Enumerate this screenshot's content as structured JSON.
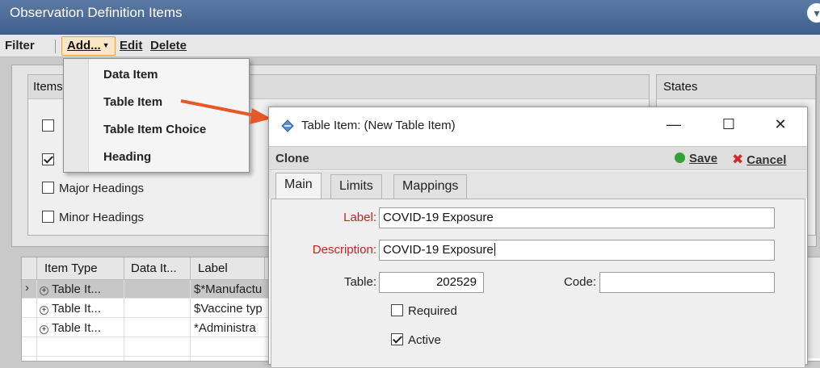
{
  "window": {
    "title": "Observation Definition Items"
  },
  "menu": {
    "filter": "Filter",
    "add": "Add...",
    "edit": "Edit",
    "delete": "Delete"
  },
  "items_panel": {
    "header": "Items",
    "checkboxes": [
      {
        "label": "Major Headings",
        "checked": false
      },
      {
        "label": "Minor Headings",
        "checked": false
      }
    ]
  },
  "states_panel": {
    "header": "States"
  },
  "add_menu": {
    "items": [
      "Data Item",
      "Table Item",
      "Table Item Choice",
      "Heading"
    ]
  },
  "grid": {
    "columns": [
      "Item Type",
      "Data It...",
      "Label"
    ],
    "rows": [
      {
        "type": "Table It...",
        "data_item": "",
        "label": "$*Manufactu",
        "selected": true
      },
      {
        "type": "Table It...",
        "data_item": "",
        "label": "$Vaccine typ",
        "selected": false
      },
      {
        "type": "Table It...",
        "data_item": "",
        "label": "*Administra",
        "selected": false
      }
    ]
  },
  "dialog": {
    "title": "Table Item: (New Table Item)",
    "toolbar": {
      "clone": "Clone",
      "save": "Save",
      "cancel": "Cancel"
    },
    "tabs": [
      "Main",
      "Limits",
      "Mappings"
    ],
    "active_tab": "Main",
    "fields": {
      "label_caption": "Label:",
      "label_value": "COVID-19 Exposure",
      "description_caption": "Description:",
      "description_value": "COVID-19 Exposure",
      "table_caption": "Table:",
      "table_value": "202529",
      "code_caption": "Code:",
      "code_value": ""
    },
    "checkboxes": [
      {
        "label": "Required",
        "checked": false
      },
      {
        "label": "Active",
        "checked": true
      }
    ]
  },
  "colors": {
    "titlebar": "#4a6a98",
    "required_label": "#d02020",
    "arrow": "#e8572a",
    "save_green": "#33a133"
  }
}
